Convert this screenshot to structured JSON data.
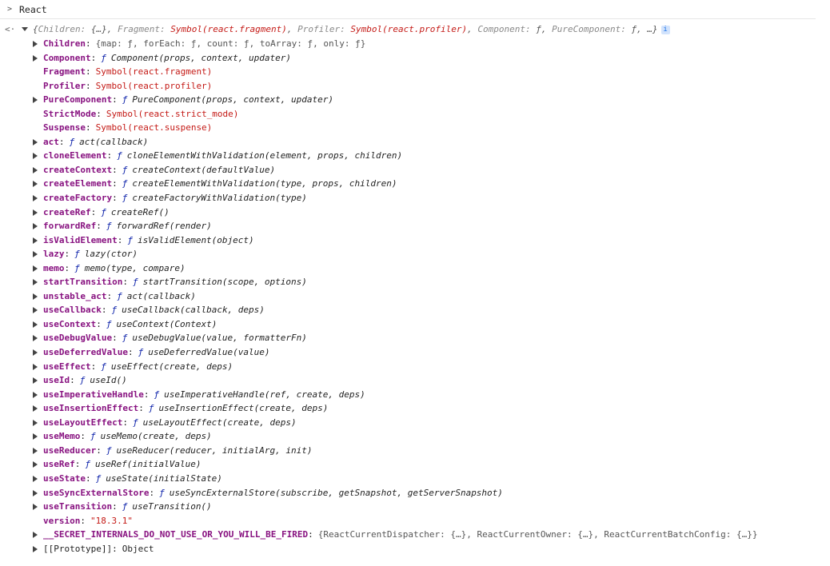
{
  "console": {
    "input_prompt": ">",
    "input_command": "React",
    "return_arrow": "<·",
    "summary": {
      "open": "{",
      "children_key": "Children",
      "children_val": "{…}",
      "fragment_key": "Fragment",
      "fragment_val": "Symbol(react.fragment)",
      "profiler_key": "Profiler",
      "profiler_val": "Symbol(react.profiler)",
      "component_key": "Component",
      "component_val": "ƒ",
      "pure_key": "PureComponent",
      "pure_val": "ƒ",
      "tail": "…}",
      "info": "i"
    },
    "rows": [
      {
        "expandable": true,
        "key": "Children",
        "kind": "preview",
        "value": "{map: ƒ, forEach: ƒ, count: ƒ, toArray: ƒ, only: ƒ}"
      },
      {
        "expandable": true,
        "key": "Component",
        "kind": "function",
        "value": "Component(props, context, updater)"
      },
      {
        "expandable": false,
        "key": "Fragment",
        "kind": "symbol",
        "value": "Symbol(react.fragment)"
      },
      {
        "expandable": false,
        "key": "Profiler",
        "kind": "symbol",
        "value": "Symbol(react.profiler)"
      },
      {
        "expandable": true,
        "key": "PureComponent",
        "kind": "function",
        "value": "PureComponent(props, context, updater)"
      },
      {
        "expandable": false,
        "key": "StrictMode",
        "kind": "symbol",
        "value": "Symbol(react.strict_mode)"
      },
      {
        "expandable": false,
        "key": "Suspense",
        "kind": "symbol",
        "value": "Symbol(react.suspense)"
      },
      {
        "expandable": true,
        "key": "act",
        "kind": "function",
        "value": "act(callback)"
      },
      {
        "expandable": true,
        "key": "cloneElement",
        "kind": "function",
        "value": "cloneElementWithValidation(element, props, children)"
      },
      {
        "expandable": true,
        "key": "createContext",
        "kind": "function",
        "value": "createContext(defaultValue)"
      },
      {
        "expandable": true,
        "key": "createElement",
        "kind": "function",
        "value": "createElementWithValidation(type, props, children)"
      },
      {
        "expandable": true,
        "key": "createFactory",
        "kind": "function",
        "value": "createFactoryWithValidation(type)"
      },
      {
        "expandable": true,
        "key": "createRef",
        "kind": "function",
        "value": "createRef()"
      },
      {
        "expandable": true,
        "key": "forwardRef",
        "kind": "function",
        "value": "forwardRef(render)"
      },
      {
        "expandable": true,
        "key": "isValidElement",
        "kind": "function",
        "value": "isValidElement(object)"
      },
      {
        "expandable": true,
        "key": "lazy",
        "kind": "function",
        "value": "lazy(ctor)"
      },
      {
        "expandable": true,
        "key": "memo",
        "kind": "function",
        "value": "memo(type, compare)"
      },
      {
        "expandable": true,
        "key": "startTransition",
        "kind": "function",
        "value": "startTransition(scope, options)"
      },
      {
        "expandable": true,
        "key": "unstable_act",
        "kind": "function",
        "value": "act(callback)"
      },
      {
        "expandable": true,
        "key": "useCallback",
        "kind": "function",
        "value": "useCallback(callback, deps)"
      },
      {
        "expandable": true,
        "key": "useContext",
        "kind": "function",
        "value": "useContext(Context)"
      },
      {
        "expandable": true,
        "key": "useDebugValue",
        "kind": "function",
        "value": "useDebugValue(value, formatterFn)"
      },
      {
        "expandable": true,
        "key": "useDeferredValue",
        "kind": "function",
        "value": "useDeferredValue(value)"
      },
      {
        "expandable": true,
        "key": "useEffect",
        "kind": "function",
        "value": "useEffect(create, deps)"
      },
      {
        "expandable": true,
        "key": "useId",
        "kind": "function",
        "value": "useId()"
      },
      {
        "expandable": true,
        "key": "useImperativeHandle",
        "kind": "function",
        "value": "useImperativeHandle(ref, create, deps)"
      },
      {
        "expandable": true,
        "key": "useInsertionEffect",
        "kind": "function",
        "value": "useInsertionEffect(create, deps)"
      },
      {
        "expandable": true,
        "key": "useLayoutEffect",
        "kind": "function",
        "value": "useLayoutEffect(create, deps)"
      },
      {
        "expandable": true,
        "key": "useMemo",
        "kind": "function",
        "value": "useMemo(create, deps)"
      },
      {
        "expandable": true,
        "key": "useReducer",
        "kind": "function",
        "value": "useReducer(reducer, initialArg, init)"
      },
      {
        "expandable": true,
        "key": "useRef",
        "kind": "function",
        "value": "useRef(initialValue)"
      },
      {
        "expandable": true,
        "key": "useState",
        "kind": "function",
        "value": "useState(initialState)"
      },
      {
        "expandable": true,
        "key": "useSyncExternalStore",
        "kind": "function",
        "value": "useSyncExternalStore(subscribe, getSnapshot, getServerSnapshot)"
      },
      {
        "expandable": true,
        "key": "useTransition",
        "kind": "function",
        "value": "useTransition()"
      },
      {
        "expandable": false,
        "key": "version",
        "kind": "string",
        "value": "\"18.3.1\""
      },
      {
        "expandable": true,
        "key": "__SECRET_INTERNALS_DO_NOT_USE_OR_YOU_WILL_BE_FIRED",
        "kind": "preview",
        "value": "{ReactCurrentDispatcher: {…}, ReactCurrentOwner: {…}, ReactCurrentBatchConfig: {…}}"
      },
      {
        "expandable": true,
        "key": "[[Prototype]]",
        "kind": "object",
        "value": "Object",
        "dim": true
      }
    ],
    "function_marker": "ƒ"
  },
  "colors": {
    "key": "#881280",
    "symbol": "#c41a16",
    "function_marker": "#0d22aa",
    "text": "#1f1f1f"
  }
}
